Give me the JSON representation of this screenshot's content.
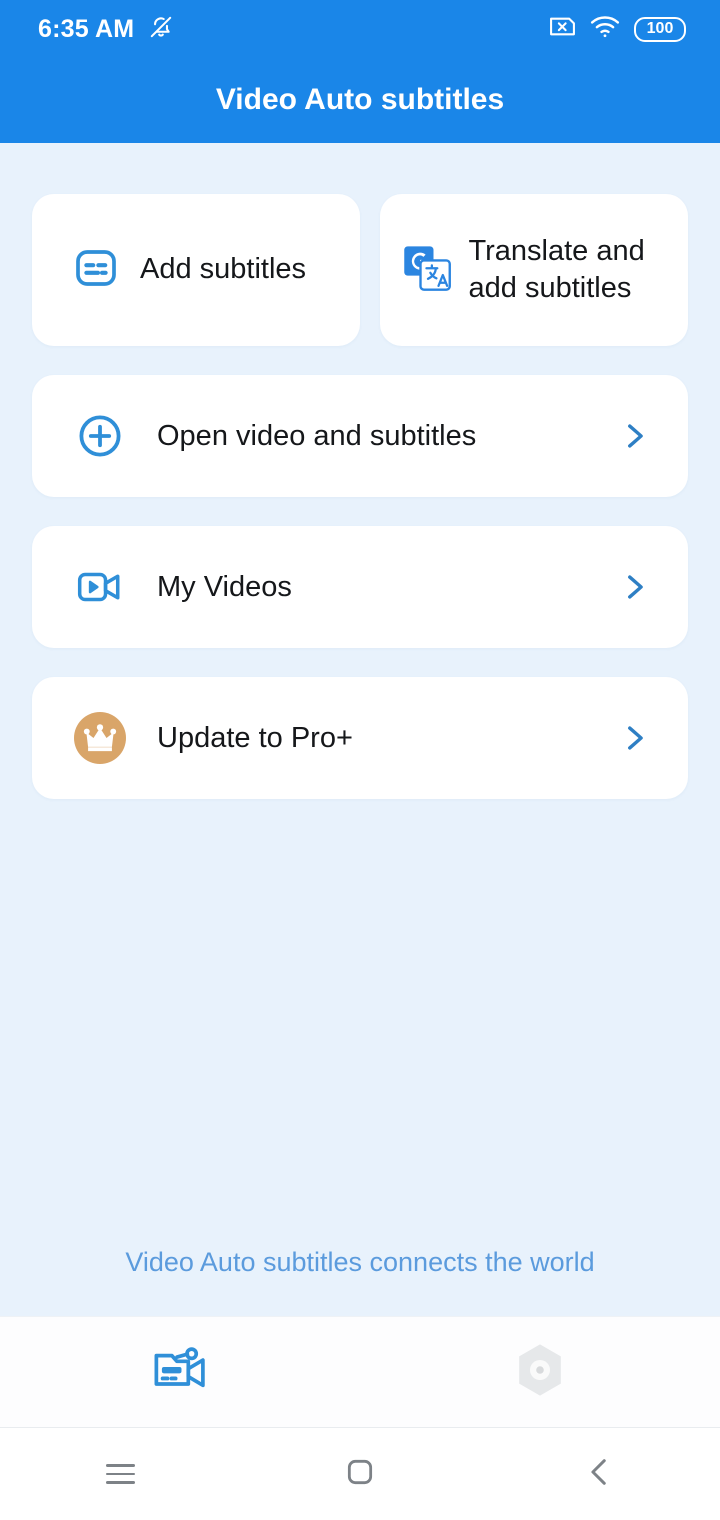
{
  "statusbar": {
    "time": "6:35 AM",
    "notifications_icon": "bell-muted-icon",
    "sim_icon": "sim-card-x-icon",
    "wifi_icon": "wifi-icon",
    "battery_icon": "battery-icon",
    "battery_level": "100"
  },
  "header": {
    "title": "Video Auto subtitles",
    "background_color": "#1a86e8"
  },
  "shortcuts": [
    {
      "label": "Add subtitles",
      "icon": "subtitles-icon",
      "icon_color": "#2f8fd8"
    },
    {
      "label": "Translate and add subtitles",
      "icon": "google-translate-icon",
      "icon_color": "#2b85e0"
    }
  ],
  "rows": [
    {
      "label": "Open video and subtitles",
      "icon": "plus-circle-icon",
      "icon_color": "#2f8fd8",
      "chevron": "chevron-right-icon"
    },
    {
      "label": "My Videos",
      "icon": "video-camera-play-icon",
      "icon_color": "#2f8fd8",
      "chevron": "chevron-right-icon"
    },
    {
      "label": "Update to Pro+",
      "icon": "crown-icon",
      "icon_color": "#d9a569",
      "chevron": "chevron-right-icon"
    }
  ],
  "tagline": "Video Auto subtitles connects the world",
  "tabbar": {
    "tabs": [
      {
        "icon": "camcorder-subtitles-icon",
        "active": true,
        "color": "#2f8fd8"
      },
      {
        "icon": "settings-hexagon-icon",
        "active": false,
        "color": "#e6e8ea"
      }
    ]
  },
  "navbar": {
    "recents_icon": "menu-icon",
    "home_icon": "home-square-icon",
    "back_icon": "chevron-left-icon"
  },
  "theme": {
    "page_background": "#e8f2fc",
    "card_background": "#ffffff",
    "accent": "#1a86e8",
    "text": "#15171a",
    "tagline_color": "#5b9bdd"
  }
}
